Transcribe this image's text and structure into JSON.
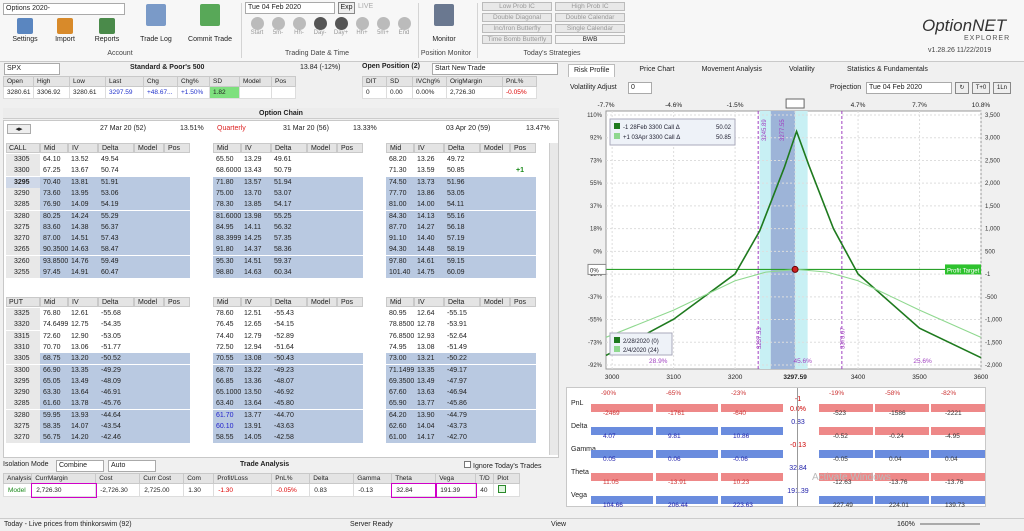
{
  "ribbon": {
    "trade_select": "Options 2020-",
    "buttons": [
      "Settings",
      "Import",
      "Reports",
      "Trade Log",
      "Commit Trade"
    ],
    "account_label": "Account",
    "date_value": "Tue 04  Feb  2020",
    "exp_label": "Exp",
    "live_label": "LIVE",
    "nav": [
      "Start",
      "5m-",
      "Hh-",
      "Day-",
      "Day+",
      "Hh+",
      "5m+",
      "End"
    ],
    "td_group": "Trading Date & Time",
    "monitor_label": "Monitor",
    "pm_group": "Position Monitor",
    "strategies": [
      [
        "Low Prob IC",
        "High Prob IC"
      ],
      [
        "Double Diagonal",
        "Double Calendar"
      ],
      [
        "Inc/Iron Butterfly",
        "Single Calendar"
      ],
      [
        "Time Bomb Butterfly",
        "BWB"
      ]
    ],
    "strat_group": "Today's Strategies",
    "logo": "OptionNET",
    "logo_sub": "EXPLORER",
    "version": "v1.28.26  11/22/2019"
  },
  "quote": {
    "symbol": "SPX",
    "name": "Standard & Poor's 500",
    "change_pct": "13.84 (-12%)",
    "headers": [
      "Open",
      "High",
      "Low",
      "Last",
      "Chg",
      "Chg%",
      "SD",
      "Model",
      "Pos"
    ],
    "values": [
      "3280.61",
      "3306.92",
      "3280.61",
      "3297.59",
      "+48.67...",
      "+1.50%",
      "1.82",
      "",
      ""
    ]
  },
  "open_position": {
    "title": "Open Position (2)",
    "new_trade": "Start New Trade",
    "headers": [
      "DIT",
      "SD",
      "IVChg%",
      "OrigMargin",
      "PnL%"
    ],
    "values": [
      "0",
      "0.00",
      "0.00%",
      "2,726.30",
      "-0.05%"
    ]
  },
  "chain": {
    "title": "Option Chain",
    "expiries": [
      {
        "label": "27 Mar 20 (52)",
        "iv": "13.51%"
      },
      {
        "label": "Quarterly",
        "sub": "31 Mar 20 (56)",
        "iv": "13.33%"
      },
      {
        "label": "03 Apr 20 (59)",
        "iv": "13.47%"
      }
    ],
    "col_headers": [
      "Mid",
      "IV",
      "Delta",
      "Model",
      "Pos"
    ],
    "call_label": "CALL",
    "put_label": "PUT",
    "call_strikes": [
      "3305",
      "3300",
      "3295",
      "3290",
      "3285",
      "3280",
      "3275",
      "3270",
      "3265",
      "3260",
      "3255"
    ],
    "call_rows": [
      [
        [
          "64.10",
          "13.52",
          "49.54"
        ],
        [
          "65.50",
          "13.29",
          "49.61"
        ],
        [
          "68.20",
          "13.26",
          "49.72"
        ]
      ],
      [
        [
          "67.25",
          "13.67",
          "50.74"
        ],
        [
          "68.60001",
          "13.43",
          "50.79"
        ],
        [
          "71.30",
          "13.59",
          "50.85"
        ]
      ],
      [
        [
          "70.40",
          "13.81",
          "51.91"
        ],
        [
          "71.80",
          "13.57",
          "51.94"
        ],
        [
          "74.50",
          "13.73",
          "51.96"
        ]
      ],
      [
        [
          "73.60",
          "13.95",
          "53.06"
        ],
        [
          "75.00",
          "13.70",
          "53.07"
        ],
        [
          "77.70",
          "13.86",
          "53.05"
        ]
      ],
      [
        [
          "76.90",
          "14.09",
          "54.19"
        ],
        [
          "78.30",
          "13.85",
          "54.17"
        ],
        [
          "81.00",
          "14.00",
          "54.11"
        ]
      ],
      [
        [
          "80.25",
          "14.24",
          "55.29"
        ],
        [
          "81.60001",
          "13.98",
          "55.25"
        ],
        [
          "84.30",
          "14.13",
          "55.16"
        ]
      ],
      [
        [
          "83.60",
          "14.38",
          "56.37"
        ],
        [
          "84.95",
          "14.11",
          "56.32"
        ],
        [
          "87.70",
          "14.27",
          "56.18"
        ]
      ],
      [
        [
          "87.00",
          "14.51",
          "57.43"
        ],
        [
          "88.39999",
          "14.25",
          "57.35"
        ],
        [
          "91.10",
          "14.40",
          "57.19"
        ]
      ],
      [
        [
          "90.35001",
          "14.63",
          "58.47"
        ],
        [
          "91.80",
          "14.37",
          "58.36"
        ],
        [
          "94.30",
          "14.48",
          "58.19"
        ]
      ],
      [
        [
          "93.85001",
          "14.76",
          "59.49"
        ],
        [
          "95.30",
          "14.51",
          "59.37"
        ],
        [
          "97.80",
          "14.61",
          "59.15"
        ]
      ],
      [
        [
          "97.45",
          "14.91",
          "60.47"
        ],
        [
          "98.80",
          "14.63",
          "60.34"
        ],
        [
          "101.40",
          "14.75",
          "60.09"
        ]
      ]
    ],
    "call_pos": "+1",
    "put_strikes": [
      "3325",
      "3320",
      "3315",
      "3310",
      "3305",
      "3300",
      "3295",
      "3290",
      "3285",
      "3280",
      "3275",
      "3270"
    ],
    "put_rows": [
      [
        [
          "76.80",
          "12.61",
          "-55.68"
        ],
        [
          "78.60",
          "12.51",
          "-55.43"
        ],
        [
          "80.95",
          "12.64",
          "-55.15"
        ]
      ],
      [
        [
          "74.64999",
          "12.75",
          "-54.35"
        ],
        [
          "76.45",
          "12.65",
          "-54.15"
        ],
        [
          "78.85001",
          "12.78",
          "-53.91"
        ]
      ],
      [
        [
          "72.60",
          "12.90",
          "-53.05"
        ],
        [
          "74.40",
          "12.79",
          "-52.89"
        ],
        [
          "76.85001",
          "12.93",
          "-52.64"
        ]
      ],
      [
        [
          "70.70",
          "13.06",
          "-51.77"
        ],
        [
          "72.50",
          "12.94",
          "-51.64"
        ],
        [
          "74.95",
          "13.08",
          "-51.49"
        ]
      ],
      [
        [
          "68.75",
          "13.20",
          "-50.52"
        ],
        [
          "70.55",
          "13.08",
          "-50.43"
        ],
        [
          "73.00",
          "13.21",
          "-50.22"
        ]
      ],
      [
        [
          "66.90",
          "13.35",
          "-49.29"
        ],
        [
          "68.70",
          "13.22",
          "-49.23"
        ],
        [
          "71.14999",
          "13.35",
          "-49.17"
        ]
      ],
      [
        [
          "65.05",
          "13.49",
          "-48.09"
        ],
        [
          "66.85",
          "13.36",
          "-48.07"
        ],
        [
          "69.35001",
          "13.49",
          "-47.97"
        ]
      ],
      [
        [
          "63.30",
          "13.64",
          "-46.91"
        ],
        [
          "65.10001",
          "13.50",
          "-46.92"
        ],
        [
          "67.60",
          "13.63",
          "-46.94"
        ]
      ],
      [
        [
          "61.60",
          "13.78",
          "-45.76"
        ],
        [
          "63.40",
          "13.64",
          "-45.80"
        ],
        [
          "65.90",
          "13.77",
          "-45.86"
        ]
      ],
      [
        [
          "59.95",
          "13.93",
          "-44.64"
        ],
        [
          "61.70",
          "13.77",
          "-44.70"
        ],
        [
          "64.20",
          "13.90",
          "-44.79"
        ]
      ],
      [
        [
          "58.35",
          "14.07",
          "-43.54"
        ],
        [
          "60.10",
          "13.91",
          "-43.63"
        ],
        [
          "62.60",
          "14.04",
          "-43.73"
        ]
      ],
      [
        [
          "56.75",
          "14.20",
          "-42.46"
        ],
        [
          "58.55",
          "14.05",
          "-42.58"
        ],
        [
          "61.00",
          "14.17",
          "-42.70"
        ]
      ]
    ]
  },
  "trade_analysis": {
    "title": "Trade Analysis",
    "isolation_label": "Isolation Mode",
    "iso_sel": "Combine",
    "auto_sel": "Auto",
    "ignore_label": "Ignore Today's Trades",
    "headers": [
      "Analysis",
      "CurrMargin",
      "Cost",
      "Curr Cost",
      "Com",
      "Profit/Loss",
      "PnL%",
      "Delta",
      "Gamma",
      "Theta",
      "Vega",
      "T/D",
      "Plot"
    ],
    "values": [
      "Model",
      "2,726.30",
      "-2,726.30",
      "2,725.00",
      "1.30",
      "-1.30",
      "-0.05%",
      "0.83",
      "-0.13",
      "32.84",
      "191.39",
      "40",
      ""
    ]
  },
  "tabs": [
    "Risk Profile",
    "Price Chart",
    "Movement Analysis",
    "Volatility",
    "Statistics & Fundamentals"
  ],
  "risk": {
    "vol_label": "Volatility Adjust",
    "vol_value": "0",
    "proj_label": "Projection",
    "proj_date": "Tue 04  Feb  2020",
    "tplus": "T+0",
    "oneln": "1Ln",
    "legend": [
      "-1 28Feb 3300 Call Δ",
      "+1 03Apr 3300 Call Δ"
    ],
    "legend_vals": [
      "50.02",
      "50.85"
    ],
    "legend2": [
      "2/28/2020 (0)",
      "2/4/2020 (24)"
    ],
    "profit_target": "Profit Target",
    "pt_val": "-1"
  },
  "chart_data": {
    "type": "line",
    "top_axis": [
      "-7.7%",
      "-4.6%",
      "-1.5%",
      "1.5%",
      "4.7%",
      "7.7%",
      "10.8%"
    ],
    "x_ticks": [
      "3000",
      "3100",
      "3200",
      "3297.59",
      "3400",
      "3500",
      "3600"
    ],
    "xlim": [
      2990,
      3600
    ],
    "y_left": [
      "110%",
      "92%",
      "73%",
      "55%",
      "37%",
      "18%",
      "0%",
      "-18%",
      "-37%",
      "-55%",
      "-73%",
      "-92%"
    ],
    "y_right": [
      "3,500",
      "3,000",
      "2,500",
      "2,000",
      "1,500",
      "1,000",
      "500",
      "-1",
      "-500",
      "-1,000",
      "-1,500",
      "-2,000"
    ],
    "ylim": [
      -2200,
      3500
    ],
    "band_labels": [
      "3245.89",
      "3277.55",
      "3237.53",
      "3373.67"
    ],
    "pct_labels": [
      "28.9%",
      "45.6%",
      "25.6%"
    ],
    "series": [
      {
        "name": "2/28/2020 (0)",
        "color": "#1e7a1e",
        "x": [
          2990,
          3100,
          3200,
          3240,
          3280,
          3300,
          3320,
          3360,
          3400,
          3500,
          3600
        ],
        "y": [
          -1900,
          -1100,
          -100,
          850,
          2250,
          3050,
          2300,
          900,
          -100,
          -1300,
          -1950
        ]
      },
      {
        "name": "2/4/2020 (24)",
        "color": "#8fd88f",
        "x": [
          2990,
          3100,
          3200,
          3250,
          3300,
          3350,
          3400,
          3500,
          3600
        ],
        "y": [
          -1500,
          -900,
          -250,
          -60,
          0,
          -60,
          -250,
          -900,
          -1500
        ]
      }
    ]
  },
  "greeks": {
    "rows": [
      "PnL",
      "Delta",
      "Gamma",
      "Theta",
      "Vega"
    ],
    "center": [
      "-1",
      "0.83",
      "-0.13",
      "32.84",
      "191.39"
    ],
    "center_sub": [
      "0.0%",
      "",
      "",
      "",
      ""
    ],
    "left_top": [
      [
        "-90%",
        "-65%",
        "-23%"
      ],
      [
        "",
        "",
        ""
      ],
      [
        "",
        "",
        ""
      ],
      [
        "",
        "",
        ""
      ],
      [
        "",
        "",
        ""
      ]
    ],
    "left_vals": [
      [
        "-2469",
        "-1761",
        "-640"
      ],
      [
        "4.07",
        "9.81",
        "10.86"
      ],
      [
        "0.05",
        "0.06",
        "-0.06"
      ],
      [
        "11.05",
        "-13.91",
        "10.23"
      ],
      [
        "104.66",
        "206.44",
        "223.63"
      ]
    ],
    "right_top": [
      [
        "-19%",
        "-58%",
        "-82%"
      ]
    ],
    "right_vals": [
      [
        "-523",
        "-1586",
        "-2221"
      ],
      [
        "-0.52",
        "-0.24",
        "-4.95"
      ],
      [
        "-0.05",
        "0.04",
        "0.04"
      ],
      [
        "-12.63",
        "-13.76",
        "-13.76"
      ],
      [
        "227.49",
        "224.01",
        "139.73"
      ]
    ]
  },
  "status": {
    "live": "Today - Live prices from thinkorswim (92)",
    "server": "Server Ready",
    "view": "View",
    "zoom": "160%"
  },
  "watermark": "Activate Windows"
}
